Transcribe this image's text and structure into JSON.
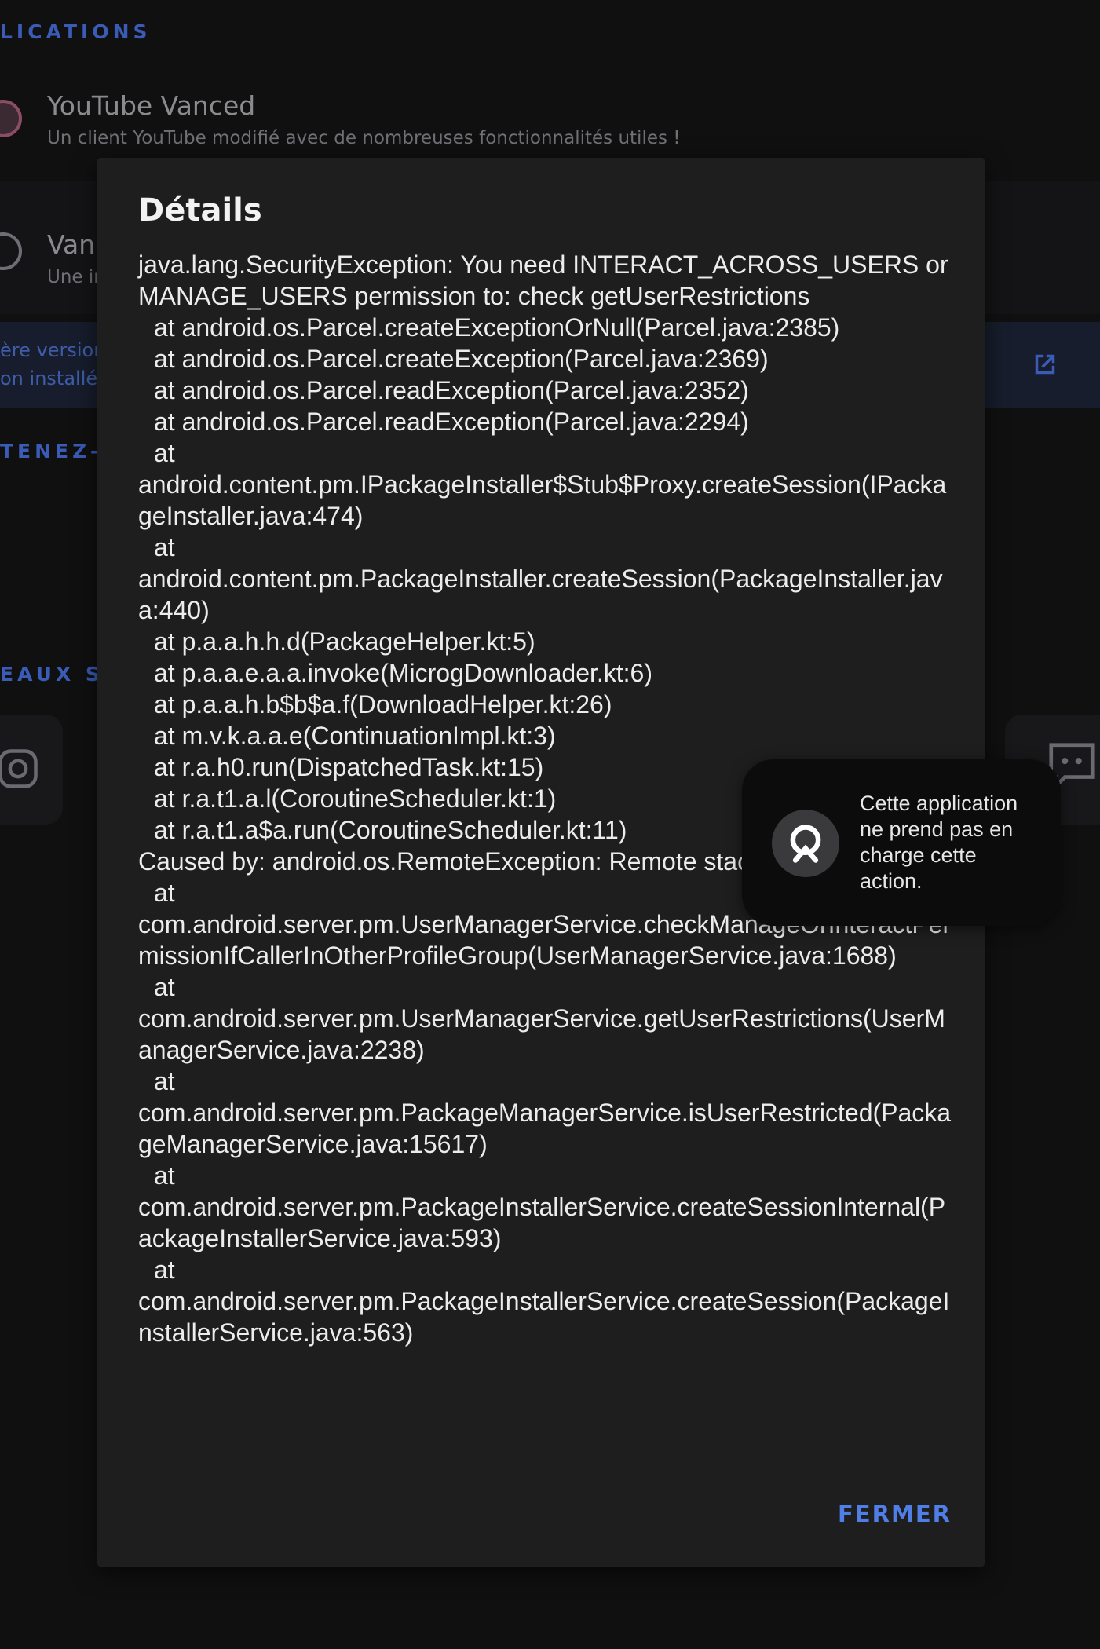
{
  "background": {
    "section_applications": "LICATIONS",
    "apps": [
      {
        "name": "YouTube Vanced",
        "description": "Un client YouTube modifié avec de nombreuses fonctionnalités utiles !"
      },
      {
        "name": "Vanc",
        "description": "Une ir"
      }
    ],
    "version_latest": "ère version:",
    "version_installed": "on installée:",
    "section_support": "TENEZ-N",
    "section_social": "EAUX SO"
  },
  "dialog": {
    "title": "Détails",
    "trace": [
      {
        "kind": "plain",
        "text": "java.lang.SecurityException: You need INTERACT_ACROSS_USERS or MANAGE_USERS permission to: check getUserRestrictions"
      },
      {
        "kind": "frame",
        "text": "at android.os.Parcel.createExceptionOrNull(Parcel.java:2385)"
      },
      {
        "kind": "frame",
        "text": "at android.os.Parcel.createException(Parcel.java:2369)"
      },
      {
        "kind": "frame",
        "text": "at android.os.Parcel.readException(Parcel.java:2352)"
      },
      {
        "kind": "frame",
        "text": "at android.os.Parcel.readException(Parcel.java:2294)"
      },
      {
        "kind": "frame",
        "text": "at"
      },
      {
        "kind": "plain",
        "text": "android.content.pm.IPackageInstaller$Stub$Proxy.createSession(IPackageInstaller.java:474)"
      },
      {
        "kind": "frame",
        "text": "at"
      },
      {
        "kind": "plain",
        "text": "android.content.pm.PackageInstaller.createSession(PackageInstaller.java:440)"
      },
      {
        "kind": "frame",
        "text": "at p.a.a.h.h.d(PackageHelper.kt:5)"
      },
      {
        "kind": "frame",
        "text": "at p.a.a.e.a.a.invoke(MicrogDownloader.kt:6)"
      },
      {
        "kind": "frame",
        "text": "at p.a.a.h.b$b$a.f(DownloadHelper.kt:26)"
      },
      {
        "kind": "frame",
        "text": "at m.v.k.a.a.e(ContinuationImpl.kt:3)"
      },
      {
        "kind": "frame",
        "text": "at r.a.h0.run(DispatchedTask.kt:15)"
      },
      {
        "kind": "frame",
        "text": "at r.a.t1.a.l(CoroutineScheduler.kt:1)"
      },
      {
        "kind": "frame",
        "text": "at r.a.t1.a$a.run(CoroutineScheduler.kt:11)"
      },
      {
        "kind": "plain",
        "text": "Caused by: android.os.RemoteException: Remote stack trace:"
      },
      {
        "kind": "frame",
        "text": "at"
      },
      {
        "kind": "plain",
        "text": "com.android.server.pm.UserManagerService.checkManageOrInteractPermissionIfCallerInOtherProfileGroup(UserManagerService.java:1688)"
      },
      {
        "kind": "frame",
        "text": "at"
      },
      {
        "kind": "plain",
        "text": "com.android.server.pm.UserManagerService.getUserRestrictions(UserManagerService.java:2238)"
      },
      {
        "kind": "frame",
        "text": "at"
      },
      {
        "kind": "plain",
        "text": "com.android.server.pm.PackageManagerService.isUserRestricted(PackageManagerService.java:15617)"
      },
      {
        "kind": "frame",
        "text": "at"
      },
      {
        "kind": "plain",
        "text": "com.android.server.pm.PackageInstallerService.createSessionInternal(PackageInstallerService.java:593)"
      },
      {
        "kind": "frame",
        "text": "at"
      },
      {
        "kind": "plain",
        "text": "com.android.server.pm.PackageInstallerService.createSession(PackageInstallerService.java:563)"
      }
    ],
    "close_label": "FERMER"
  },
  "toast": {
    "icon": "app-logo-icon",
    "message": "Cette application ne prend pas en charge cette action."
  },
  "colors": {
    "accent": "#4f7ee6",
    "dialog_bg": "#1e1e1f",
    "screen_bg": "#101011",
    "toast_bg": "#0c0c0c"
  }
}
